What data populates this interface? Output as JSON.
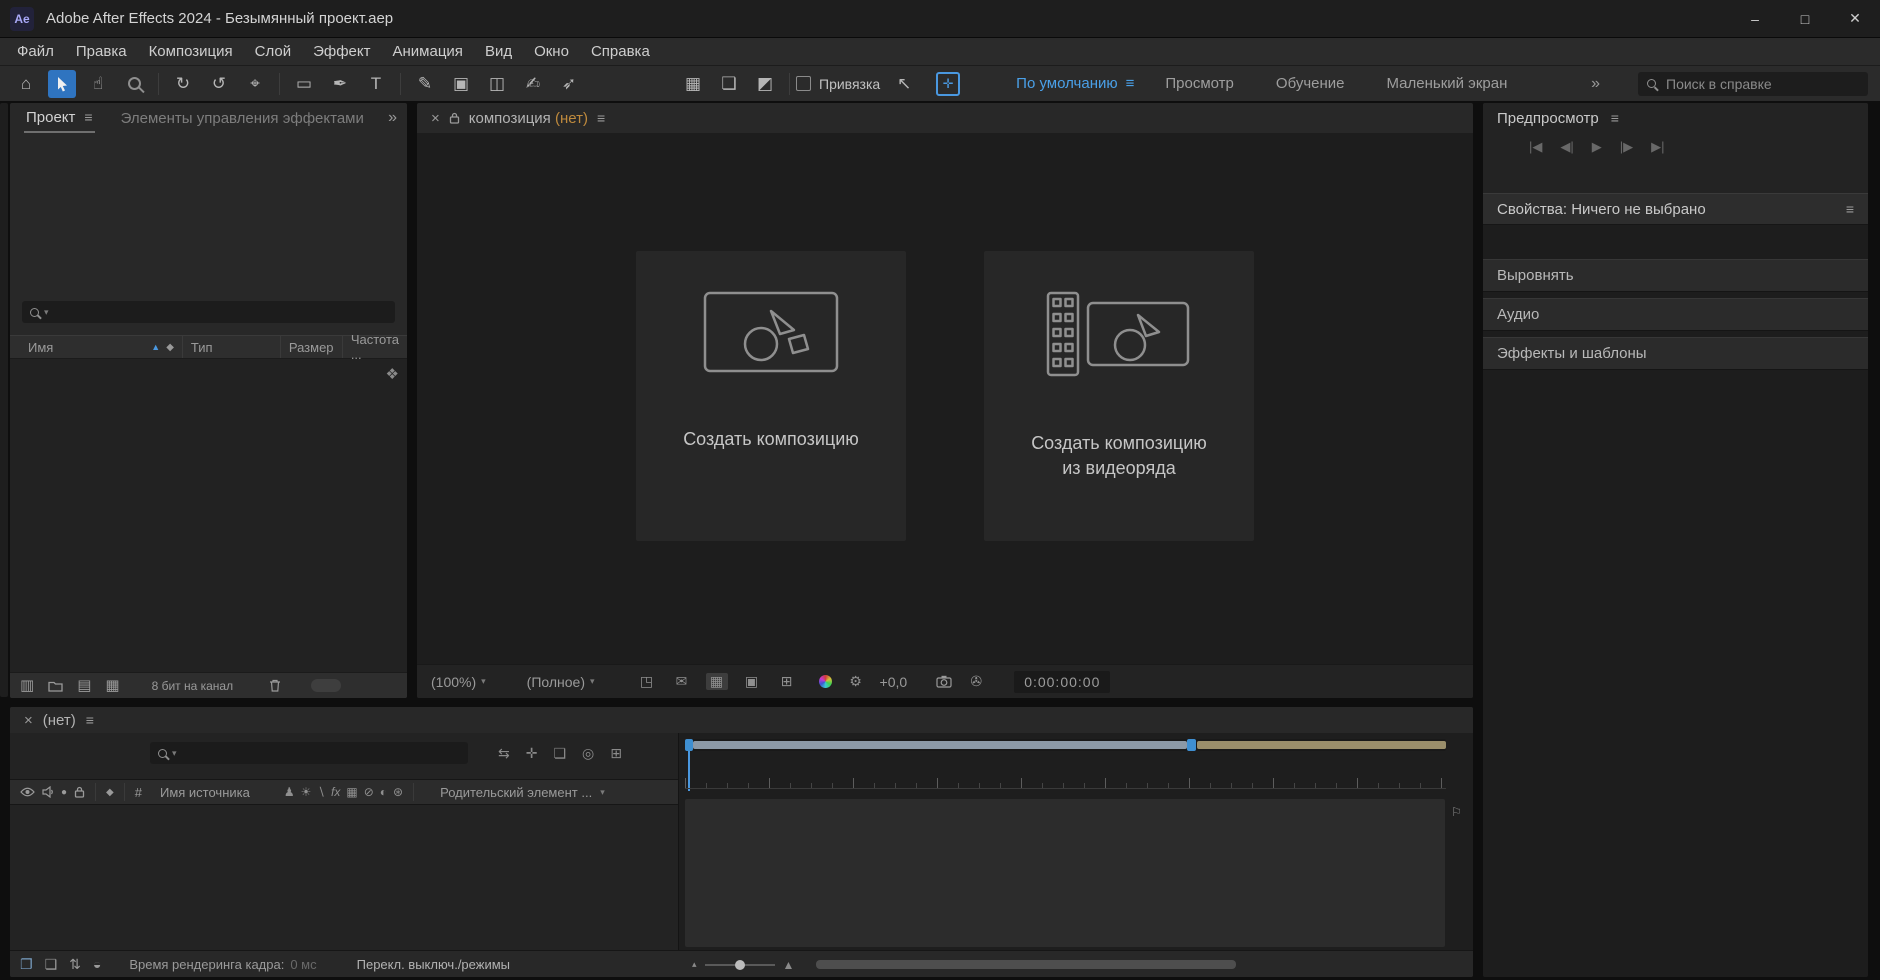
{
  "titlebar": {
    "app_badge": "Ae",
    "title": "Adobe After Effects 2024 - Безымянный проект.aep",
    "minimize": "–",
    "maximize": "□",
    "close": "✕"
  },
  "menubar": {
    "items": [
      "Файл",
      "Правка",
      "Композиция",
      "Слой",
      "Эффект",
      "Анимация",
      "Вид",
      "Окно",
      "Справка"
    ]
  },
  "icons": {
    "menu": "≡",
    "overflow": "»",
    "close_tab": "×",
    "sort_asc": "▲",
    "tag": "◆",
    "flowchart": "❖",
    "caret": "▾",
    "marker_flag": "⚐",
    "zoom_small": "▴",
    "zoom_large": "▲"
  },
  "toolbar": {
    "tools": {
      "home": "⌂",
      "hand": "☝",
      "rotate": "↻",
      "orbit": "↺",
      "pan_behind": "⌖",
      "rect_mask": "▭",
      "pen": "✒",
      "type": "T",
      "brush": "✎",
      "stamp": "▣",
      "eraser": "◫",
      "roto_brush": "✍",
      "puppet_pin": "➶",
      "layer_a": "▦",
      "layer_b": "❏",
      "layer_c": "◩",
      "mini_arrows": "↖",
      "crosshair": "✛"
    },
    "snap_label": "Привязка",
    "workspaces": [
      "По умолчанию",
      "Просмотр",
      "Обучение",
      "Маленький экран"
    ],
    "search_placeholder": "Поиск в справке"
  },
  "project": {
    "tab_project": "Проект",
    "tab_effects": "Элементы управления эффектами",
    "col_name": "Имя",
    "col_type": "Тип",
    "col_size": "Размер",
    "col_rate": "Частота ...",
    "footer_icons": [
      "▥",
      "▤",
      "▦"
    ],
    "bit_depth": "8 бит на канал"
  },
  "comp": {
    "title": "композиция",
    "none": "(нет)",
    "card_new_comp": "Создать композицию",
    "card_from_footage_1": "Создать композицию",
    "card_from_footage_2": "из видеоряда",
    "zoom": "(100%)",
    "resolution": "(Полное)",
    "footer_icons": [
      "◳",
      "✉",
      "▦",
      "▣",
      "⊞"
    ],
    "gear": "⚙",
    "exposure": "+0,0",
    "link": "✇",
    "timecode": "0:00:00:00"
  },
  "preview": {
    "title": "Предпросмотр",
    "buttons": [
      "|◀",
      "◀|",
      "▶",
      "|▶",
      "▶|"
    ]
  },
  "properties": {
    "title": "Свойства: Ничего не выбрано"
  },
  "right_sections": [
    "Выровнять",
    "Аудио",
    "Эффекты и шаблоны"
  ],
  "timeline": {
    "tab": "(нет)",
    "top_icons": [
      "⇆",
      "✛",
      "❏",
      "◎",
      "⊞"
    ],
    "solo": "●",
    "hash": "#",
    "source_name": "Имя источника",
    "switches": [
      "♟",
      "☀",
      "∖",
      "fx",
      "▦",
      "⊘",
      "◐",
      "⊛"
    ],
    "parent": "Родительский элемент ..."
  },
  "statusbar": {
    "footer_icons": [
      "❐",
      "❏",
      "⇅",
      "◒"
    ],
    "render_label": "Время рендеринга кадра:",
    "render_value": "0 мс",
    "modes_label": "Перекл. выключ./режимы"
  }
}
